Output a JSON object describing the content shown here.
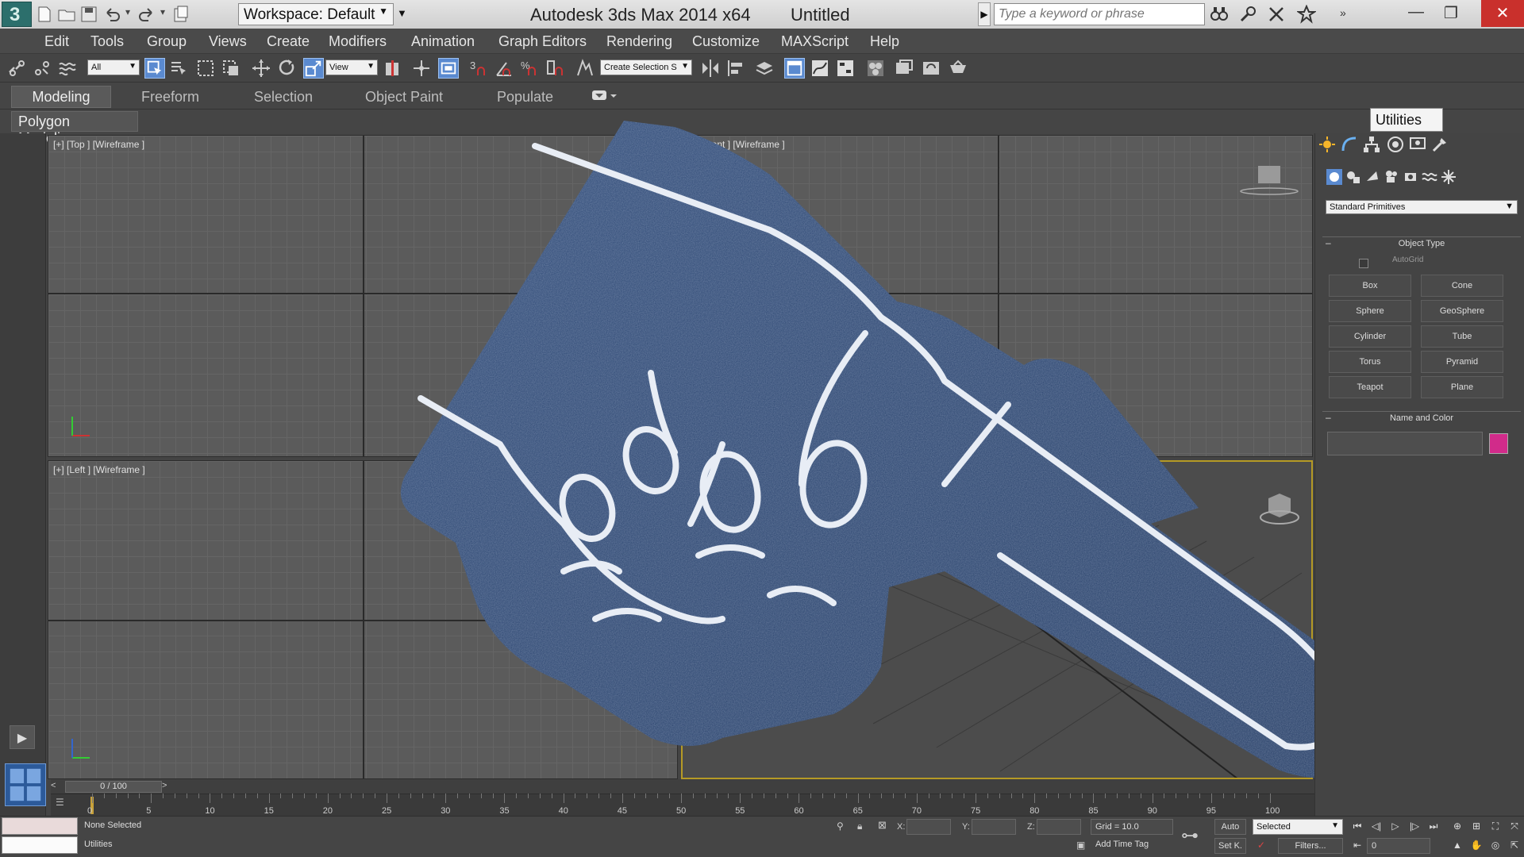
{
  "title_bar": {
    "app_title": "Autodesk 3ds Max  2014 x64",
    "document_title": "Untitled",
    "workspace_label": "Workspace: Default",
    "search_placeholder": "Type a keyword or phrase"
  },
  "menu": {
    "items": [
      "Edit",
      "Tools",
      "Group",
      "Views",
      "Create",
      "Modifiers",
      "Animation",
      "Graph Editors",
      "Rendering",
      "Customize",
      "MAXScript",
      "Help"
    ]
  },
  "toolbar": {
    "selection_filter": "All",
    "ref_coord": "View",
    "named_selection": "Create Selection S"
  },
  "ribbon": {
    "tabs": [
      "Modeling",
      "Freeform",
      "Selection",
      "Object Paint",
      "Populate"
    ],
    "active_panel": "Polygon Modeling"
  },
  "viewports": {
    "top_label": "[+] [Top ] [Wireframe ]",
    "front_label": "[+] [Front ] [Wireframe ]",
    "left_label": "[+] [Left ] [Wireframe ]"
  },
  "command_panel": {
    "tooltip": "Utilities",
    "category": "Standard Primitives",
    "object_type_title": "Object Type",
    "autogrid_label": "AutoGrid",
    "primitives": [
      "Box",
      "Cone",
      "Sphere",
      "GeoSphere",
      "Cylinder",
      "Tube",
      "Torus",
      "Pyramid",
      "Teapot",
      "Plane"
    ],
    "name_color_title": "Name and Color",
    "object_color": "#d12b8a"
  },
  "timeline": {
    "position": "0 / 100",
    "ticks": [
      "0",
      "5",
      "10",
      "15",
      "20",
      "25",
      "30",
      "35",
      "40",
      "45",
      "50",
      "55",
      "60",
      "65",
      "70",
      "75",
      "80",
      "85",
      "90",
      "95",
      "100"
    ]
  },
  "status": {
    "selection": "None Selected",
    "prompt": "Utilities",
    "x_label": "X:",
    "y_label": "Y:",
    "z_label": "Z:",
    "grid": "Grid = 10.0",
    "add_time_tag": "Add Time Tag",
    "auto_key": "Auto",
    "set_key": "Set K.",
    "key_filter": "Selected",
    "filters": "Filters...",
    "frame": "0"
  },
  "colors": {
    "accent_blue": "#5a8ad0",
    "close_red": "#c9302c",
    "viewport_border_active": "#b59a25",
    "foam_hand": "#2b4571"
  },
  "icons": [
    "app-logo-icon",
    "new-file-icon",
    "open-file-icon",
    "save-icon",
    "undo-icon",
    "redo-icon",
    "project-folder-icon",
    "infocenter-search-icon",
    "subscription-icon",
    "communication-icon",
    "favorites-icon",
    "link-icon",
    "unlink-icon",
    "bind-space-warp-icon",
    "select-object-icon",
    "select-by-name-icon",
    "rect-region-icon",
    "window-crossing-icon",
    "move-icon",
    "rotate-icon",
    "scale-icon",
    "mirror-icon",
    "align-icon",
    "layer-manager-icon",
    "curve-editor-icon",
    "material-editor-icon",
    "render-setup-icon",
    "render-icon",
    "create-tab-icon",
    "modify-tab-icon",
    "hierarchy-tab-icon",
    "motion-tab-icon",
    "display-tab-icon",
    "utilities-tab-icon",
    "geometry-icon",
    "shapes-icon",
    "lights-icon",
    "cameras-icon",
    "helpers-icon",
    "space-warps-icon",
    "systems-icon",
    "foam-finger-hand-image"
  ]
}
